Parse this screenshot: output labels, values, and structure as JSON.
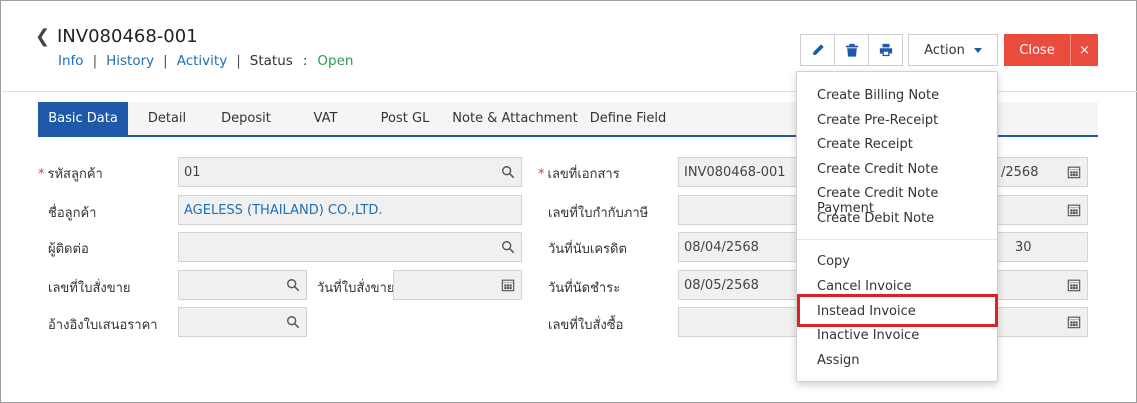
{
  "header": {
    "back_icon": "chevron-left-icon",
    "doc_no": "INV080468-001",
    "nav": [
      "Info",
      "History",
      "Activity"
    ],
    "nav_sep": "|",
    "status_label": "Status",
    "status_colon": ":",
    "status_value": "Open"
  },
  "toolbar": {
    "edit_icon": "pencil-icon",
    "delete_icon": "trash-icon",
    "print_icon": "printer-icon",
    "action_label": "Action",
    "close_label": "Close",
    "close_x": "×"
  },
  "tabs": [
    "Basic Data",
    "Detail",
    "Deposit",
    "VAT",
    "Post GL",
    "Note & Attachment",
    "Define Field"
  ],
  "form": {
    "customer_code_label": "รหัสลูกค้า",
    "customer_code": "01",
    "customer_name_label": "ชื่อลูกค้า",
    "customer_name": "AGELESS (THAILAND) CO.,LTD.",
    "contact_label": "ผู้ติดต่อ",
    "so_no_label": "เลขที่ใบสั่งขาย",
    "so_date_label": "วันที่ใบสั่งขาย",
    "quotation_label": "อ้างอิงใบเสนอราคา",
    "doc_no_label": "เลขที่เอกสาร",
    "doc_no": "INV080468-001",
    "doc_date_partial": "/2568",
    "tax_invoice_label": "เลขที่ใบกำกับภาษี",
    "credit_start_label": "วันที่นับเครดิต",
    "credit_start": "08/04/2568",
    "credit_days": "30",
    "due_date_label": "วันที่นัดชำระ",
    "due_date": "08/05/2568",
    "po_no_label": "เลขที่ใบสั่งซื้อ",
    "required_mark": "*"
  },
  "action_menu": {
    "group1": [
      "Create Billing Note",
      "Create Pre-Receipt",
      "Create Receipt",
      "Create Credit Note",
      "Create Credit Note Payment",
      "Create Debit Note"
    ],
    "group2": [
      "Copy",
      "Cancel Invoice",
      "Instead Invoice",
      "Inactive Invoice",
      "Assign"
    ],
    "highlighted": "Instead Invoice"
  },
  "colors": {
    "accent": "#1e5aa8",
    "close_button": "#e94b3c",
    "status_open": "#2e9b4e",
    "highlight_box": "#d8232a"
  }
}
